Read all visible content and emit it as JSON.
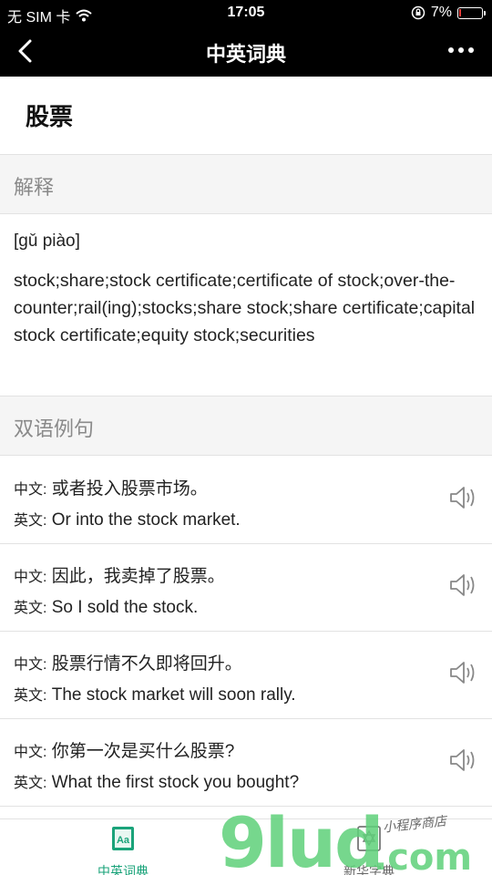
{
  "status": {
    "carrier": "无 SIM 卡",
    "time": "17:05",
    "battery": "7%",
    "battery_level": 0.07
  },
  "nav": {
    "title": "中英词典"
  },
  "word": "股票",
  "sections": {
    "explanation": "解释",
    "examples": "双语例句"
  },
  "pinyin": "[gǔ piào]",
  "definition": "stock;share;stock certificate;certificate of stock;over-the-counter;rail(ing);stocks;share stock;share certificate;capital stock certificate;equity stock;securities",
  "examples": [
    {
      "zh_tag": "中文:",
      "zh": "或者投入股票市场。",
      "en_tag": "英文:",
      "en": "Or into the stock market."
    },
    {
      "zh_tag": "中文:",
      "zh": "因此，我卖掉了股票。",
      "en_tag": "英文:",
      "en": "So I sold the stock."
    },
    {
      "zh_tag": "中文:",
      "zh": "股票行情不久即将回升。",
      "en_tag": "英文:",
      "en": "The stock market will soon rally."
    },
    {
      "zh_tag": "中文:",
      "zh": "你第一次是买什么股票?",
      "en_tag": "英文:",
      "en": "What the first stock you bought?"
    }
  ],
  "tabs": [
    {
      "label": "中英词典",
      "icon": "dictionary-aa-icon",
      "active": true,
      "icon_text": "Aa"
    },
    {
      "label": "新华字典",
      "icon": "xinhua-dictionary-icon",
      "active": false
    }
  ],
  "watermark": {
    "text": "9lud",
    "suffix": ".com",
    "sub": "小程序商店"
  },
  "colors": {
    "nav_bg": "#000000",
    "accent": "#1aa37a",
    "section_bg": "#f5f5f5",
    "battery_low": "#e53935"
  }
}
